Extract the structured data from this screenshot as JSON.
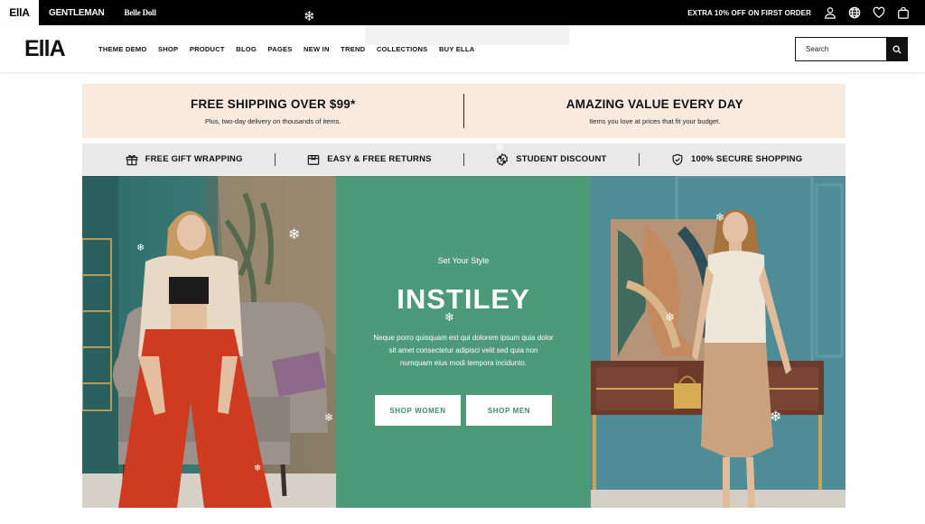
{
  "topbar": {
    "brands": [
      "EllA",
      "GENTLEMAN",
      "Belle Doll"
    ],
    "promo": "EXTRA 10% OFF ON FIRST ORDER",
    "icons": [
      "user-icon",
      "globe-icon",
      "heart-icon",
      "bag-icon"
    ]
  },
  "header": {
    "logo": "EllA",
    "nav": [
      "THEME DEMO",
      "SHOP",
      "PRODUCT",
      "BLOG",
      "PAGES",
      "NEW IN",
      "TREND",
      "COLLECTIONS",
      "BUY ELLA"
    ],
    "search_placeholder": "Search"
  },
  "shipping": [
    {
      "title": "FREE SHIPPING OVER $99*",
      "subtitle": "Plus, two-day delivery on thousands of items."
    },
    {
      "title": "AMAZING VALUE EVERY DAY",
      "subtitle": "Items you love at prices that fit your budget."
    }
  ],
  "features": [
    {
      "icon": "gift-icon",
      "label": "FREE GIFT WRAPPING"
    },
    {
      "icon": "box-icon",
      "label": "EASY & FREE RETURNS"
    },
    {
      "icon": "discount-icon",
      "label": "STUDENT DISCOUNT"
    },
    {
      "icon": "shield-check-icon",
      "label": "100% SECURE SHOPPING"
    }
  ],
  "hero": {
    "kicker": "Set Your Style",
    "title": "INSTILEY",
    "text": "Neque porro quisquam est qui dolorem ipsum quia dolor sit amet consectetur adipisci velit sed quia non numquam eius modi tempora incidunto.",
    "buttons": [
      "SHOP WOMEN",
      "SHOP MEN"
    ]
  },
  "colors": {
    "topbar": "#000000",
    "banner_bg": "#f9eae0",
    "features_bg": "#e9e9e9",
    "hero_green": "#4c9a78"
  }
}
